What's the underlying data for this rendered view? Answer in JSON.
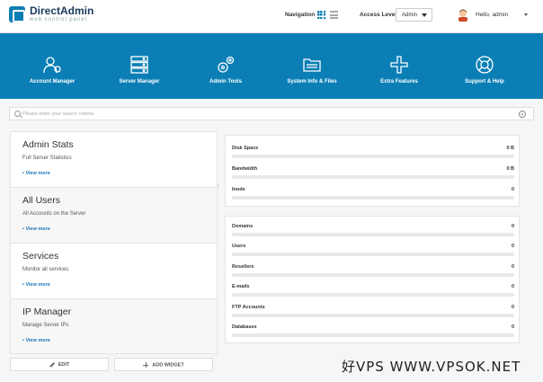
{
  "header": {
    "logo_title": "DirectAdmin",
    "logo_sub": "web control panel",
    "navigation_label": "Navigation",
    "access_level_label": "Access Level",
    "access_level_value": "Admin",
    "greeting": "Hello,",
    "username": "admin"
  },
  "nav": [
    {
      "label": "Account Manager",
      "icon": "users-icon"
    },
    {
      "label": "Server Manager",
      "icon": "server-icon"
    },
    {
      "label": "Admin Tools",
      "icon": "tools-icon"
    },
    {
      "label": "System Info & Files",
      "icon": "folder-icon"
    },
    {
      "label": "Extra Features",
      "icon": "plus-icon"
    },
    {
      "label": "Support & Help",
      "icon": "lifebuoy-icon"
    }
  ],
  "search": {
    "placeholder": "Please enter your search criteria"
  },
  "widgets": [
    {
      "title": "Admin Stats",
      "sub": "Full Server Statistics",
      "more": "• View more"
    },
    {
      "title": "All Users",
      "sub": "All Accounts on the Server",
      "more": "• View more"
    },
    {
      "title": "Services",
      "sub": "Monitor all services",
      "more": "• View more"
    },
    {
      "title": "IP Manager",
      "sub": "Manage Server IPs",
      "more": "• View more"
    }
  ],
  "buttons": {
    "edit": "EDIT",
    "add_widget": "ADD WIDGET"
  },
  "usage": [
    {
      "name": "Disk Space",
      "value": "0 B",
      "fraction": 0
    },
    {
      "name": "Bandwidth",
      "value": "0 B",
      "fraction": 0
    },
    {
      "name": "Inode",
      "value": "0",
      "fraction": 0
    }
  ],
  "counts": [
    {
      "name": "Domains",
      "value": "0",
      "fraction": 0
    },
    {
      "name": "Users",
      "value": "0",
      "fraction": 0
    },
    {
      "name": "Resellers",
      "value": "0",
      "fraction": 0
    },
    {
      "name": "E-mails",
      "value": "0",
      "fraction": 0
    },
    {
      "name": "FTP Accounts",
      "value": "0",
      "fraction": 0
    },
    {
      "name": "Databases",
      "value": "0",
      "fraction": 0
    }
  ],
  "watermark": "好VPS WWW.VPSOK.NET",
  "colors": {
    "accent": "#0b7fb5",
    "link": "#1b75b8"
  }
}
